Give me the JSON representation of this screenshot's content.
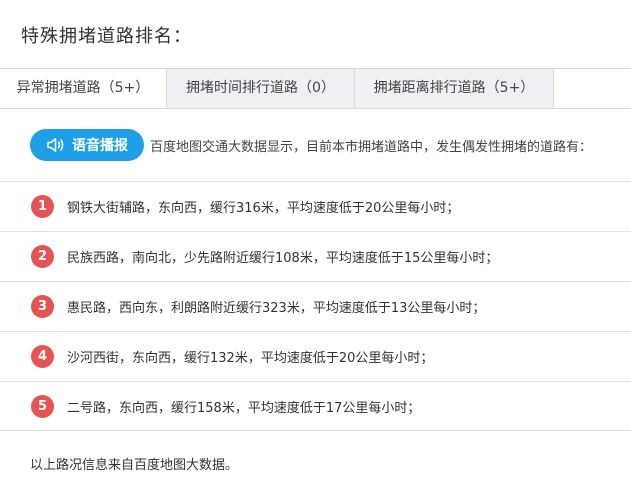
{
  "page": {
    "title": "特殊拥堵道路排名："
  },
  "tabs": [
    {
      "label": "异常拥堵道路（5+）",
      "active": true
    },
    {
      "label": "拥堵时间排行道路（0）",
      "active": false
    },
    {
      "label": "拥堵距离排行道路（5+）",
      "active": false
    }
  ],
  "intro": {
    "voice_button_label": "语音播报",
    "voice_icon": "speaker-icon",
    "text": "百度地图交通大数据显示，目前本市拥堵道路中，发生偶发性拥堵的道路有："
  },
  "roads": [
    {
      "rank": "1",
      "text": "钢铁大街辅路，东向西，缓行316米，平均速度低于20公里每小时；"
    },
    {
      "rank": "2",
      "text": "民族西路，南向北，少先路附近缓行108米，平均速度低于15公里每小时；"
    },
    {
      "rank": "3",
      "text": "惠民路，西向东，利朗路附近缓行323米，平均速度低于13公里每小时；"
    },
    {
      "rank": "4",
      "text": "沙河西街，东向西，缓行132米，平均速度低于20公里每小时；"
    },
    {
      "rank": "5",
      "text": "二号路，东向西，缓行158米，平均速度低于17公里每小时；"
    }
  ],
  "footer": {
    "text": "以上路况信息来自百度地图大数据。"
  },
  "colors": {
    "accent_blue": "#1f9fe8",
    "rank_red": "#e55353",
    "tab_inactive_bg": "#eef0f3"
  }
}
